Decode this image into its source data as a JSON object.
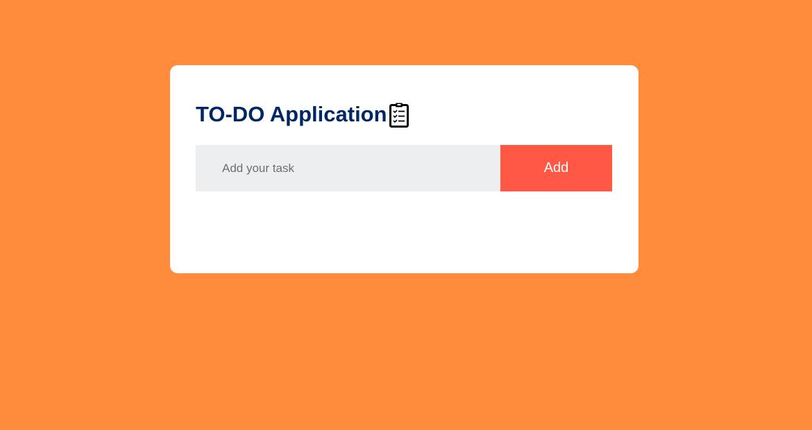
{
  "app": {
    "title": "TO-DO Application",
    "title_icon": "clipboard-icon"
  },
  "task_form": {
    "input_value": "",
    "input_placeholder": "Add your task",
    "add_label": "Add"
  },
  "colors": {
    "background": "#ff8b3b",
    "card": "#ffffff",
    "title": "#002765",
    "input_bg": "#edeef0",
    "button_bg": "#ff5945",
    "button_text": "#ffffff"
  },
  "tasks": []
}
